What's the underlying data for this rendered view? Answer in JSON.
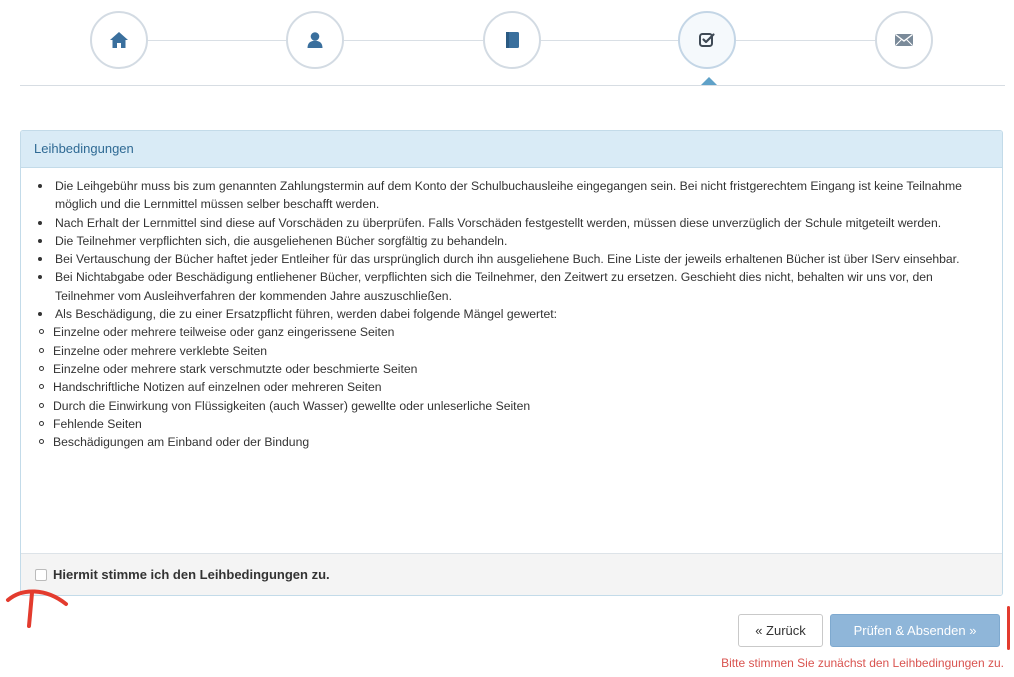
{
  "wizard": {
    "steps": [
      {
        "icon": "home-icon"
      },
      {
        "icon": "user-icon"
      },
      {
        "icon": "book-icon"
      },
      {
        "icon": "check-square-icon",
        "active": true
      },
      {
        "icon": "envelope-icon"
      }
    ]
  },
  "panel": {
    "title": "Leihbedingungen",
    "items": [
      "Die Leihgebühr muss bis zum genannten Zahlungstermin auf dem Konto der Schulbuchausleihe eingegangen sein. Bei nicht fristgerechtem Eingang ist keine Teilnahme möglich und die Lernmittel müssen selber beschafft werden.",
      "Nach Erhalt der Lernmittel sind diese auf Vorschäden zu überprüfen. Falls Vorschäden festgestellt werden, müssen diese unverzüglich der Schule mitgeteilt werden.",
      "Die Teilnehmer verpflichten sich, die ausgeliehenen Bücher sorgfältig zu behandeln.",
      "Bei Vertauschung der Bücher haftet jeder Entleiher für das ursprünglich durch ihn ausgeliehene Buch. Eine Liste der jeweils erhaltenen Bücher ist über IServ einsehbar.",
      "Bei Nichtabgabe oder Beschädigung entliehener Bücher, verpflichten sich die Teilnehmer, den Zeitwert zu ersetzen. Geschieht dies nicht, behalten wir uns vor, den Teilnehmer vom Ausleihverfahren der kommenden Jahre auszuschließen.",
      "Als Beschädigung, die zu einer Ersatzpflicht führen, werden dabei folgende Mängel gewertet:"
    ],
    "subitems": [
      "Einzelne oder mehrere teilweise oder ganz eingerissene Seiten",
      "Einzelne oder mehrere verklebte Seiten",
      "Einzelne oder mehrere stark verschmutzte oder beschmierte Seiten",
      "Handschriftliche Notizen auf einzelnen oder mehreren Seiten",
      "Durch die Einwirkung von Flüssigkeiten (auch Wasser) gewellte oder unleserliche Seiten",
      "Fehlende Seiten",
      "Beschädigungen am Einband oder der Bindung"
    ],
    "agree_label": "Hiermit stimme ich den Leihbedingungen zu.",
    "agree_checked": false
  },
  "buttons": {
    "back_label": "« Zurück",
    "submit_label": "Prüfen & Absenden »"
  },
  "error_message": "Bitte stimmen Sie zunächst den Leihbedingungen zu.",
  "colors": {
    "heading_bg": "#d9ebf6",
    "heading_text": "#2f6a94",
    "icon": "#3a6f9d",
    "submit_bg": "#8fb6d9",
    "error": "#d9534f",
    "annotation": "#e33b2e"
  }
}
